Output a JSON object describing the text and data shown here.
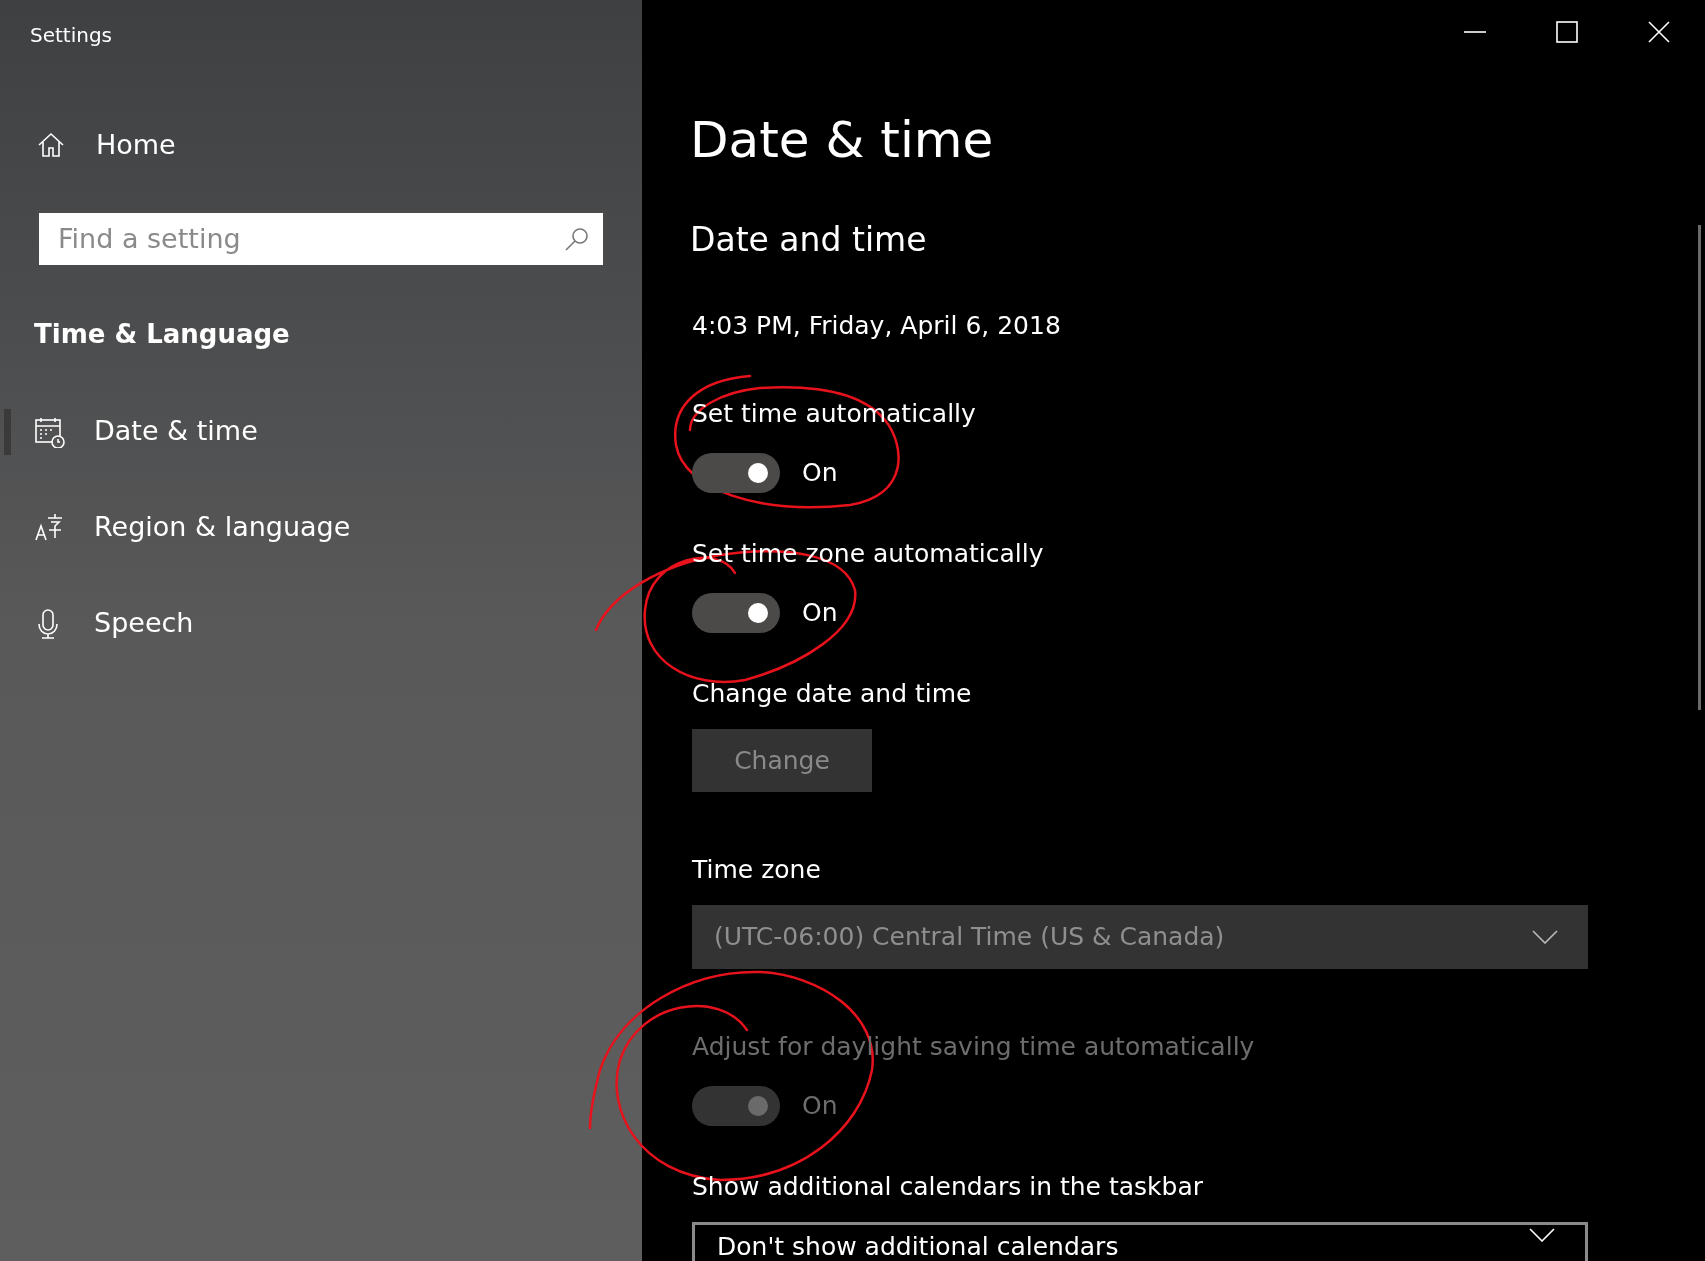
{
  "window": {
    "title": "Settings"
  },
  "sidebar": {
    "home": "Home",
    "search": {
      "placeholder": "Find a setting"
    },
    "section": "Time & Language",
    "items": [
      {
        "label": "Date & time",
        "selected": true
      },
      {
        "label": "Region & language",
        "selected": false
      },
      {
        "label": "Speech",
        "selected": false
      }
    ]
  },
  "main": {
    "page_title": "Date & time",
    "section_title": "Date and time",
    "current_datetime": "4:03 PM, Friday, April 6, 2018",
    "settings": [
      {
        "kind": "toggle",
        "label": "Set time automatically",
        "on": true,
        "disabled": false,
        "state_text": "On"
      },
      {
        "kind": "toggle",
        "label": "Set time zone automatically",
        "on": true,
        "disabled": false,
        "state_text": "On"
      },
      {
        "kind": "button",
        "label": "Change date and time",
        "button": "Change",
        "disabled": true
      },
      {
        "kind": "dropdown",
        "label": "Time zone",
        "value": "(UTC-06:00) Central Time (US & Canada)",
        "disabled": true
      },
      {
        "kind": "toggle",
        "label": "Adjust for daylight saving time automatically",
        "on": true,
        "disabled": true,
        "state_text": "On"
      },
      {
        "kind": "dropdown",
        "label": "Show additional calendars in the taskbar",
        "value": "Don't show additional calendars",
        "disabled": false
      }
    ]
  }
}
